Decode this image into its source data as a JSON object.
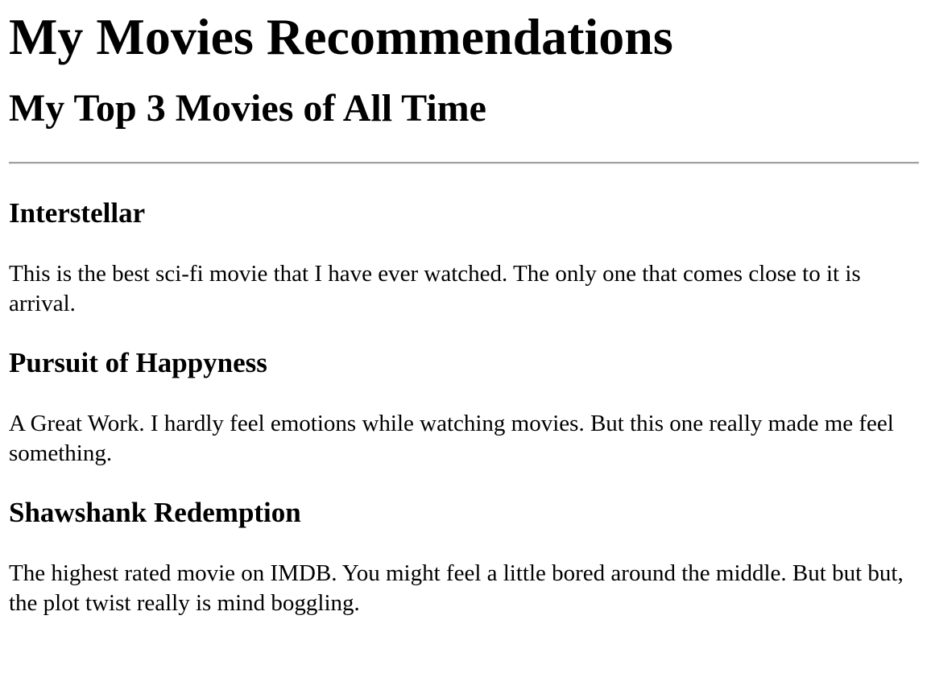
{
  "page": {
    "title": "My Movies Recommendations",
    "subtitle": "My Top 3 Movies of All Time"
  },
  "movies": [
    {
      "title": "Interstellar",
      "description": "This is the best sci-fi movie that I have ever watched. The only one that comes close to it is arrival."
    },
    {
      "title": "Pursuit of Happyness",
      "description": "A Great Work. I hardly feel emotions while watching movies. But this one really made me feel something."
    },
    {
      "title": "Shawshank Redemption",
      "description": "The highest rated movie on IMDB. You might feel a little bored around the middle. But but but, the plot twist really is mind boggling."
    }
  ]
}
